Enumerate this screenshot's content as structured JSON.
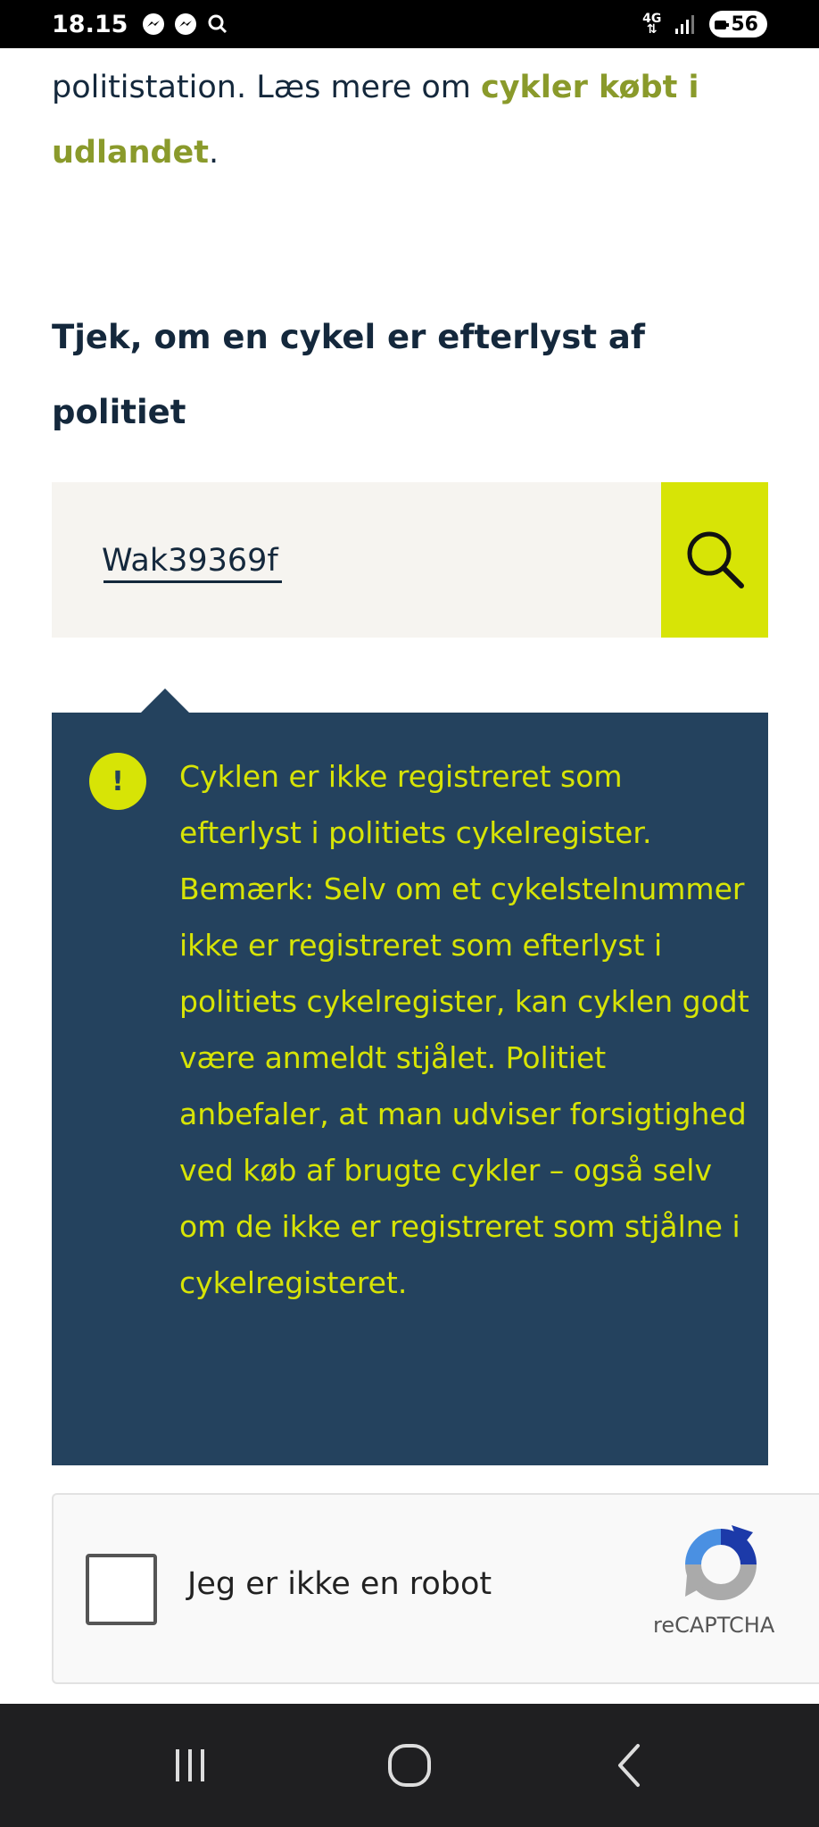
{
  "status_bar": {
    "time": "18.15",
    "network": "4G",
    "battery": "56"
  },
  "intro": {
    "text_before": "politistation. Læs mere om ",
    "link": "cykler købt i udlandet",
    "text_after": "."
  },
  "heading": "Tjek, om en cykel er efterlyst af politiet",
  "search": {
    "value": "Wak39369f",
    "button_icon": "search-icon"
  },
  "result": {
    "icon_label": "!",
    "message": "Cyklen er ikke registreret som efterlyst i politiets cykelregister. Bemærk: Selv om et cykelstelnummer ikke er registreret som efterlyst i politiets cykelregister, kan cyklen godt være anmeldt stjålet. Politiet anbefaler, at man udviser forsigtighed ved køb af brugte cykler – også selv om de ikke er registreret som stjålne i cykelregisteret."
  },
  "recaptcha": {
    "label": "Jeg er ikke en robot",
    "brand": "reCAPTCHA"
  },
  "colors": {
    "link": "#8a9a2b",
    "accent": "#d7e406",
    "callout_bg": "#24425e",
    "text": "#14283c",
    "search_bg": "#f6f4f0"
  },
  "nav_bar": {
    "recents_icon": "recents-icon",
    "home_icon": "home-icon",
    "back_icon": "back-icon"
  }
}
